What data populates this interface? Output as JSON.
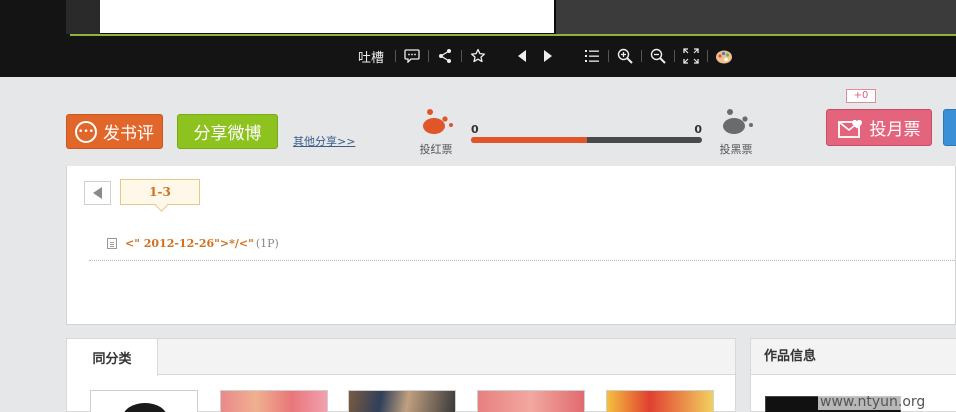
{
  "toolbar": {
    "comment_label": "吐槽",
    "icons": [
      "speech-bubble-icon",
      "share-icon",
      "star-icon",
      "prev-page-icon",
      "next-page-icon",
      "list-icon",
      "zoom-in-icon",
      "zoom-out-icon",
      "fullscreen-icon",
      "palette-icon"
    ]
  },
  "actions": {
    "review_label": "发书评",
    "share_weibo_label": "分享微博",
    "other_share_label": "其他分享>>",
    "red_vote_label": "投红票",
    "black_vote_label": "投黑票",
    "red_count": "0",
    "black_count": "0",
    "red_fraction": 0.5,
    "month_vote_label": "投月票",
    "month_vote_badge": "+0"
  },
  "chapters": {
    "pager_current": "1-3",
    "items": [
      {
        "link": "<\" 2012-12-26\">*/<\"",
        "pages": "(1P)"
      }
    ]
  },
  "similar": {
    "tab_label": "同分类"
  },
  "work_info": {
    "title": "作品信息"
  },
  "watermark": "www.ntyun.org",
  "colors": {
    "accent_green": "#8fb33d",
    "review_orange": "#e0662a",
    "share_green": "#8dc21f",
    "red_vote": "#e0552a",
    "month_pink": "#e4647e"
  }
}
